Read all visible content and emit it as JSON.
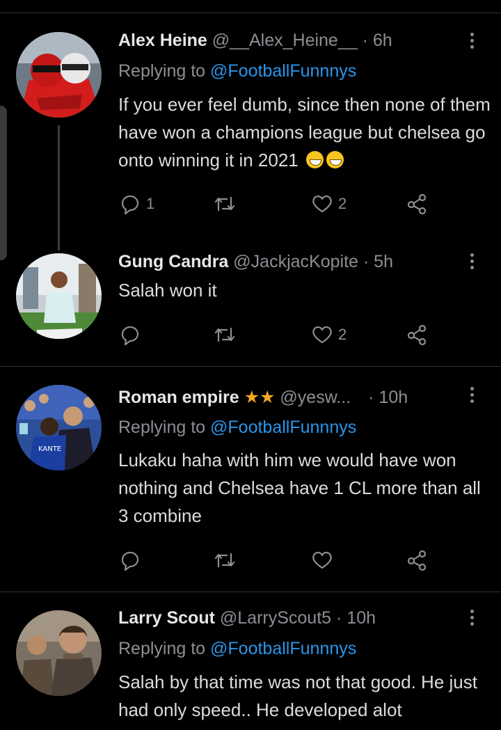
{
  "tweets": [
    {
      "name": "Alex Heine",
      "stars": "",
      "handle": "@__Alex_Heine__",
      "time": "· 6h",
      "reply_prefix": "Replying to ",
      "reply_to": "@FootballFunnnys",
      "text": "If you ever feel dumb, since then none of them have won a champions league but chelsea go onto winning it in 2021",
      "emojis": "😁😁",
      "replies": "1",
      "retweets": "",
      "likes": "2"
    },
    {
      "name": "Gung Candra",
      "stars": "",
      "handle": "@JackjacKopite",
      "time": "· 5h",
      "reply_prefix": "",
      "reply_to": "",
      "text": "Salah won it",
      "emojis": "",
      "replies": "",
      "retweets": "",
      "likes": "2"
    },
    {
      "name": "Roman empire",
      "stars": "★★",
      "handle": "@yesw...",
      "time": "· 10h",
      "reply_prefix": "Replying to ",
      "reply_to": "@FootballFunnnys",
      "text": "Lukaku haha with him we would have won nothing and Chelsea have 1 CL more than all 3 combine",
      "emojis": "",
      "replies": "",
      "retweets": "",
      "likes": ""
    },
    {
      "name": "Larry Scout",
      "stars": "",
      "handle": "@LarryScout5",
      "time": "· 10h",
      "reply_prefix": "Replying to ",
      "reply_to": "@FootballFunnnys",
      "text": "Salah by that time was not that good.  He just had only speed.. He developed alot",
      "emojis": "",
      "replies": "",
      "retweets": "",
      "likes": ""
    }
  ],
  "colors": {
    "background": "#000000",
    "accent": "#2b95e9",
    "muted": "#8b8f94",
    "star": "#f5a623"
  },
  "icons": [
    "reply-icon",
    "retweet-icon",
    "like-icon",
    "share-icon",
    "more-icon"
  ]
}
